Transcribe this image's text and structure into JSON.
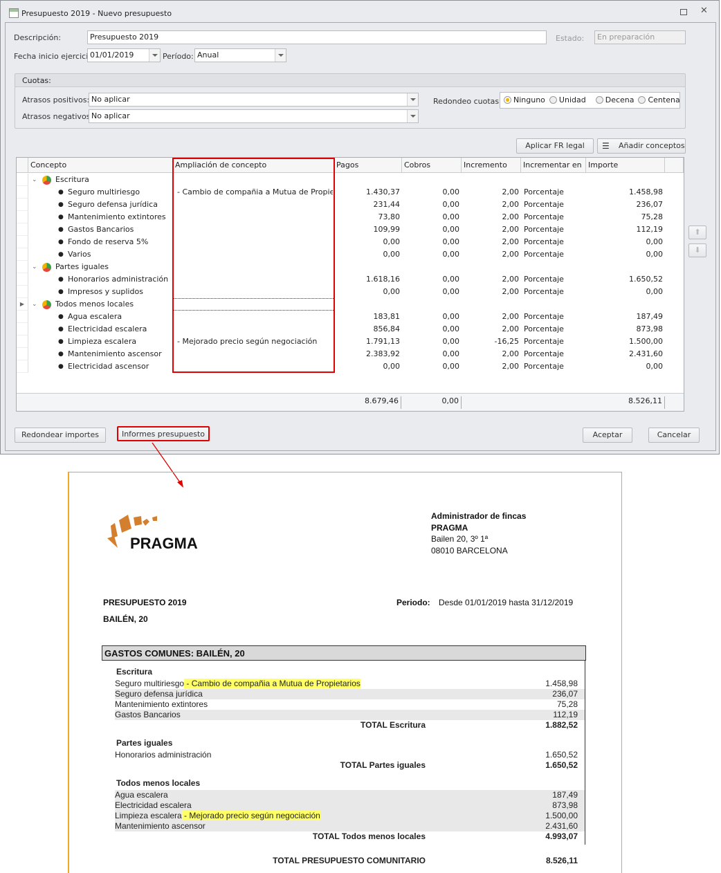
{
  "window": {
    "title": "Presupuesto 2019 - Nuevo presupuesto"
  },
  "form": {
    "descripcion_label": "Descripción:",
    "descripcion_value": "Presupuesto 2019",
    "estado_label": "Estado:",
    "estado_value": "En preparación",
    "fecha_label": "Fecha inicio ejercicio:",
    "fecha_value": "01/01/2019",
    "periodo_label": "Período:",
    "periodo_value": "Anual"
  },
  "cuotas": {
    "title": "Cuotas:",
    "pos_label": "Atrasos positivos:",
    "pos_value": "No aplicar",
    "neg_label": "Atrasos negativos:",
    "neg_value": "No aplicar",
    "redondeo_label": "Redondeo cuotas:",
    "options": [
      "Ninguno",
      "Unidad",
      "Decena",
      "Centena"
    ],
    "selected": "Ninguno"
  },
  "toolbar": {
    "aplicar": "Aplicar FR legal",
    "anadir": "Añadir conceptos"
  },
  "grid": {
    "columns": [
      "Concepto",
      "Ampliación de concepto",
      "Pagos",
      "Cobros",
      "Incremento",
      "Incrementar en",
      "Importe"
    ],
    "rows": [
      {
        "group": true,
        "concepto": "Escritura"
      },
      {
        "concepto": "Seguro multiriesgo",
        "ampliacion": "- Cambio de compañia a Mutua de Propietarios",
        "pagos": "1.430,37",
        "cobros": "0,00",
        "incremento": "2,00",
        "en": "Porcentaje",
        "importe": "1.458,98"
      },
      {
        "concepto": "Seguro defensa jurídica",
        "pagos": "231,44",
        "cobros": "0,00",
        "incremento": "2,00",
        "en": "Porcentaje",
        "importe": "236,07"
      },
      {
        "concepto": "Mantenimiento extintores",
        "pagos": "73,80",
        "cobros": "0,00",
        "incremento": "2,00",
        "en": "Porcentaje",
        "importe": "75,28"
      },
      {
        "concepto": "Gastos Bancarios",
        "pagos": "109,99",
        "cobros": "0,00",
        "incremento": "2,00",
        "en": "Porcentaje",
        "importe": "112,19"
      },
      {
        "concepto": "Fondo de reserva 5%",
        "pagos": "0,00",
        "cobros": "0,00",
        "incremento": "2,00",
        "en": "Porcentaje",
        "importe": "0,00"
      },
      {
        "concepto": "Varios",
        "pagos": "0,00",
        "cobros": "0,00",
        "incremento": "2,00",
        "en": "Porcentaje",
        "importe": "0,00"
      },
      {
        "group": true,
        "concepto": "Partes iguales"
      },
      {
        "concepto": "Honorarios administración",
        "pagos": "1.618,16",
        "cobros": "0,00",
        "incremento": "2,00",
        "en": "Porcentaje",
        "importe": "1.650,52"
      },
      {
        "concepto": "Impresos y suplidos",
        "pagos": "0,00",
        "cobros": "0,00",
        "incremento": "2,00",
        "en": "Porcentaje",
        "importe": "0,00"
      },
      {
        "group": true,
        "concepto": "Todos menos locales",
        "current": true
      },
      {
        "concepto": "Agua escalera",
        "pagos": "183,81",
        "cobros": "0,00",
        "incremento": "2,00",
        "en": "Porcentaje",
        "importe": "187,49"
      },
      {
        "concepto": "Electricidad escalera",
        "pagos": "856,84",
        "cobros": "0,00",
        "incremento": "2,00",
        "en": "Porcentaje",
        "importe": "873,98"
      },
      {
        "concepto": "Limpieza escalera",
        "ampliacion": "- Mejorado precio según negociación",
        "pagos": "1.791,13",
        "cobros": "0,00",
        "incremento": "-16,25",
        "en": "Porcentaje",
        "importe": "1.500,00"
      },
      {
        "concepto": "Mantenimiento ascensor",
        "pagos": "2.383,92",
        "cobros": "0,00",
        "incremento": "2,00",
        "en": "Porcentaje",
        "importe": "2.431,60"
      },
      {
        "concepto": "Electricidad ascensor",
        "pagos": "0,00",
        "cobros": "0,00",
        "incremento": "2,00",
        "en": "Porcentaje",
        "importe": "0,00"
      }
    ],
    "totals": {
      "pagos": "8.679,46",
      "cobros": "0,00",
      "importe": "8.526,11"
    }
  },
  "footer": {
    "redondear": "Redondear importes",
    "informes": "Informes presupuesto",
    "aceptar": "Aceptar",
    "cancelar": "Cancelar"
  },
  "report": {
    "logo": "PRAGMA",
    "company": [
      "Administrador de fincas",
      "PRAGMA",
      "Bailen 20, 3º 1ª",
      "08010 BARCELONA"
    ],
    "title": "PRESUPUESTO 2019",
    "building": "BAILÉN, 20",
    "periodo_label": "Periodo:",
    "periodo_value": "Desde 01/01/2019 hasta 31/12/2019",
    "section": "GASTOS COMUNES: BAILÉN, 20",
    "groups": [
      {
        "name": "Escritura",
        "items": [
          {
            "c": "Seguro multiriesgo",
            "a": "- Cambio de compañia a Mutua de Propietarios",
            "v": "1.458,98"
          },
          {
            "c": "Seguro defensa jurídica",
            "v": "236,07"
          },
          {
            "c": "Mantenimiento extintores",
            "v": "75,28"
          },
          {
            "c": "Gastos Bancarios",
            "v": "112,19"
          }
        ],
        "total_label": "TOTAL Escritura",
        "total": "1.882,52"
      },
      {
        "name": "Partes iguales",
        "items": [
          {
            "c": "Honorarios administración",
            "v": "1.650,52"
          }
        ],
        "total_label": "TOTAL Partes iguales",
        "total": "1.650,52"
      },
      {
        "name": "Todos menos locales",
        "items": [
          {
            "c": "Agua escalera",
            "v": "187,49"
          },
          {
            "c": "Electricidad escalera",
            "v": "873,98"
          },
          {
            "c": "Limpieza escalera",
            "a": "- Mejorado precio según negociación",
            "v": "1.500,00"
          },
          {
            "c": "Mantenimiento ascensor",
            "v": "2.431,60"
          }
        ],
        "total_label": "TOTAL Todos menos locales",
        "total": "4.993,07"
      }
    ],
    "grand_label": "TOTAL PRESUPUESTO COMUNITARIO",
    "grand_total": "8.526,11"
  },
  "colors": {
    "highlight": "#e00000",
    "accent": "#f5a623",
    "logo": "#d47f2e"
  }
}
